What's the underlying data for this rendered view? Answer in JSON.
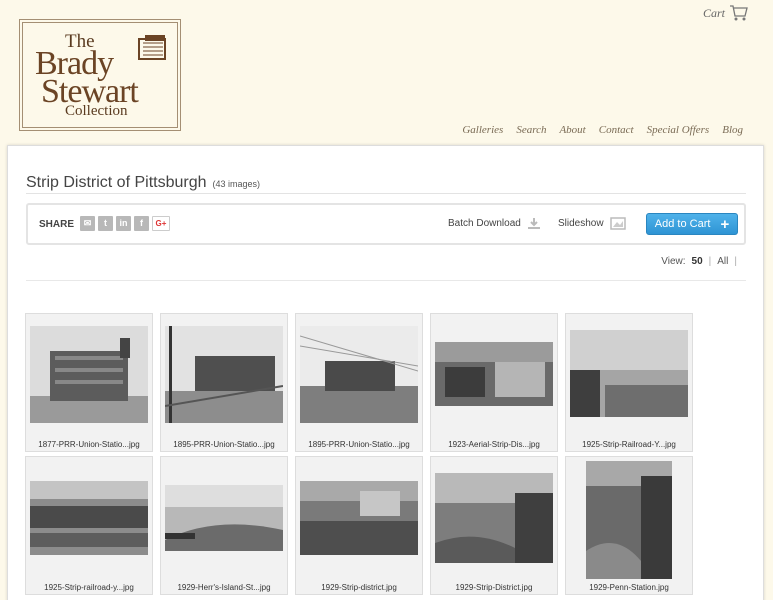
{
  "header": {
    "logo": {
      "line1": "The",
      "line2": "Brady",
      "line3": "Stewart",
      "line4": "Collection"
    },
    "cart_label": "Cart",
    "nav": [
      "Galleries",
      "Search",
      "About",
      "Contact",
      "Special Offers",
      "Blog"
    ]
  },
  "gallery": {
    "title": "Strip District of Pittsburgh",
    "count": "(43 images)"
  },
  "toolbar": {
    "share_label": "SHARE",
    "share_icons": [
      "email-icon",
      "twitter-icon",
      "linkedin-icon",
      "facebook-icon",
      "google-plus-icon"
    ],
    "gplus_text": "G+",
    "batch_label": "Batch Download",
    "slideshow_label": "Slideshow",
    "add_cart_label": "Add to Cart",
    "add_cart_plus": "+"
  },
  "view": {
    "label": "View:",
    "options": [
      "50",
      "All"
    ],
    "selected": "50"
  },
  "images": [
    "1877-PRR-Union-Statio...jpg",
    "1895-PRR-Union-Statio...jpg",
    "1895-PRR-Union-Statio...jpg",
    "1923-Aerial-Strip-Dis...jpg",
    "1925-Strip-Railroad-Y...jpg",
    "1925-Strip-railroad-y...jpg",
    "1929-Herr's-Island-St...jpg",
    "1929-Strip-district.jpg",
    "1929-Strip-District.jpg",
    "1929-Penn-Station.jpg"
  ],
  "colors": {
    "background": "#fdf9ea",
    "accent": "#2e94d4",
    "logo": "#6b4425"
  }
}
